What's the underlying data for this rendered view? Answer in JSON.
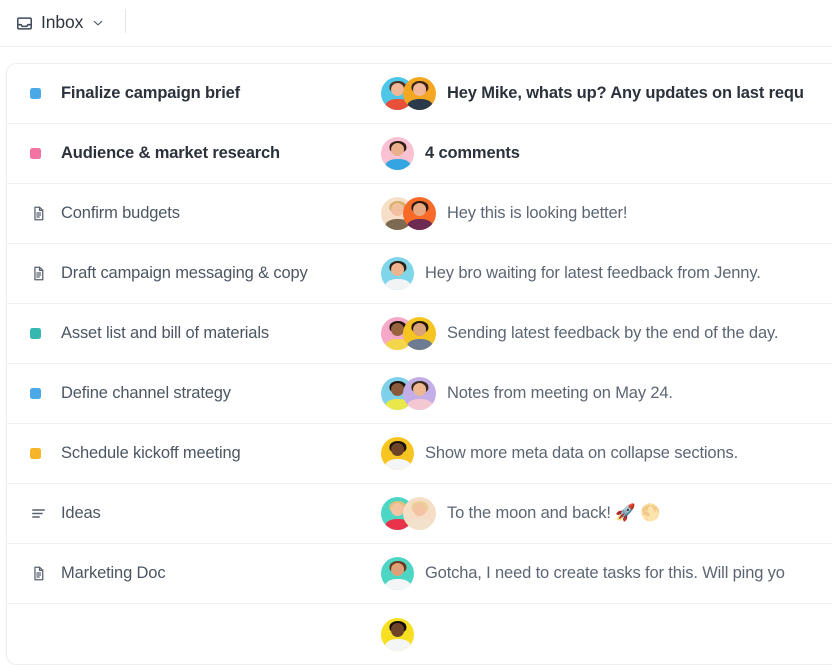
{
  "header": {
    "inbox_icon": "inbox-tray-icon",
    "label": "Inbox",
    "chevron_icon": "chevron-down-icon"
  },
  "colors": {
    "blue": "#4ba9e8",
    "pink": "#f272a4",
    "teal": "#35b8b0",
    "yellow": "#f7b52c",
    "text_default": "#5c6673",
    "text_unread": "#2b323c",
    "divider": "#f0f1f3",
    "card_border": "#eceef0"
  },
  "list": {
    "rows": [
      {
        "marker_type": "square",
        "marker_color": "#4ba9e8",
        "title": "Finalize campaign brief",
        "unread": true,
        "message": "Hey Mike, whats up? Any updates on last requ",
        "avatars": [
          {
            "bg": "#4ec6e8",
            "skin": "#f0b898",
            "hair": "#4b3226",
            "body": "#e8503a"
          },
          {
            "bg": "#f5a623",
            "skin": "#f0b898",
            "hair": "#3b2419",
            "body": "#2b3a4a"
          }
        ]
      },
      {
        "marker_type": "square",
        "marker_color": "#f272a4",
        "title": "Audience & market research",
        "unread": true,
        "message": "4 comments",
        "avatars": [
          {
            "bg": "#f9c1d2",
            "skin": "#eab08c",
            "hair": "#2f2119",
            "body": "#34a5e0"
          }
        ]
      },
      {
        "marker_type": "doc",
        "marker_color": "#58616e",
        "title": "Confirm budgets",
        "unread": false,
        "message": "Hey this is looking better!",
        "avatars": [
          {
            "bg": "#f6dfc8",
            "skin": "#f2c0a0",
            "hair": "#d8b069",
            "body": "#7d6a52"
          },
          {
            "bg": "#f86a28",
            "skin": "#e8a982",
            "hair": "#2a1a12",
            "body": "#6d2a52"
          }
        ]
      },
      {
        "marker_type": "doc",
        "marker_color": "#58616e",
        "title": "Draft campaign messaging & copy",
        "unread": false,
        "message": "Hey bro waiting for latest feedback from Jenny.",
        "avatars": [
          {
            "bg": "#7fd6ea",
            "skin": "#eeb48e",
            "hair": "#2b2119",
            "body": "#f2f3f5"
          }
        ]
      },
      {
        "marker_type": "square",
        "marker_color": "#35b8b0",
        "title": "Asset list and bill of materials",
        "unread": false,
        "message": "Sending latest feedback by the end of the day.",
        "avatars": [
          {
            "bg": "#f6a8c8",
            "skin": "#9a6340",
            "hair": "#231610",
            "body": "#f4d64a"
          },
          {
            "bg": "#f7c521",
            "skin": "#d9a278",
            "hair": "#23170f",
            "body": "#6d7c92"
          }
        ]
      },
      {
        "marker_type": "square",
        "marker_color": "#4ba9e8",
        "title": "Define channel strategy",
        "unread": false,
        "message": "Notes from meeting on May 24.",
        "avatars": [
          {
            "bg": "#7fd1ea",
            "skin": "#8a5a3a",
            "hair": "#1d1410",
            "body": "#e8e84a"
          },
          {
            "bg": "#c3aee8",
            "skin": "#edb892",
            "hair": "#3a2a1e",
            "body": "#f4c8d2"
          }
        ]
      },
      {
        "marker_type": "square",
        "marker_color": "#f7b52c",
        "title": "Schedule kickoff meeting",
        "unread": false,
        "message": "Show more meta data on collapse sections.",
        "avatars": [
          {
            "bg": "#f7c521",
            "skin": "#6d4428",
            "hair": "#1a110b",
            "body": "#f4f5f6"
          }
        ]
      },
      {
        "marker_type": "lines",
        "marker_color": "#58616e",
        "title": "Ideas",
        "unread": false,
        "message": "To the moon and back! 🚀 🌕",
        "avatars": [
          {
            "bg": "#4ed6c4",
            "skin": "#f3c3a2",
            "hair": "#e0c07a",
            "body": "#e8334a"
          },
          {
            "bg": "#f6ddc6",
            "skin": "#f3c3a2",
            "hair": "#e8d49a",
            "body": "#f2e2cc"
          }
        ]
      },
      {
        "marker_type": "doc",
        "marker_color": "#58616e",
        "title": "Marketing Doc",
        "unread": false,
        "message": "Gotcha, I need to create tasks for this. Will ping yo",
        "avatars": [
          {
            "bg": "#4ed6c4",
            "skin": "#e0a077",
            "hair": "#6a3a22",
            "body": "#f4f5f6"
          }
        ]
      },
      {
        "marker_type": "none",
        "marker_color": "#58616e",
        "title": "",
        "unread": false,
        "message": "",
        "avatars": [
          {
            "bg": "#f7e021",
            "skin": "#6d4428",
            "hair": "#120d08",
            "body": "#f4f5f6"
          }
        ]
      }
    ]
  }
}
